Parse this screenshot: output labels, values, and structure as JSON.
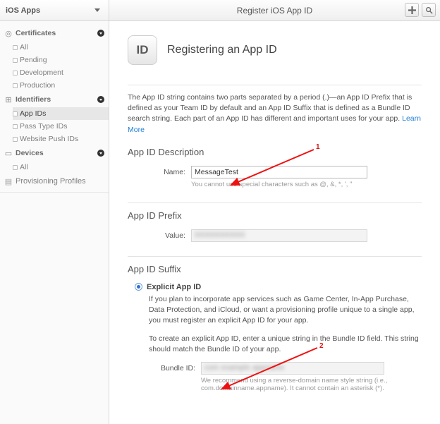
{
  "sidebar": {
    "header": "iOS Apps",
    "sections": [
      {
        "label": "Certificates",
        "items": [
          "All",
          "Pending",
          "Development",
          "Production"
        ]
      },
      {
        "label": "Identifiers",
        "items": [
          "App IDs",
          "Pass Type IDs",
          "Website Push IDs"
        ]
      },
      {
        "label": "Devices",
        "items": [
          "All"
        ]
      }
    ],
    "leaf": "Provisioning Profiles"
  },
  "header": {
    "title": "Register iOS App ID"
  },
  "page": {
    "badge": "ID",
    "title": "Registering an App ID",
    "intro": "The App ID string contains two parts separated by a period (.)—an App ID Prefix that is defined as your Team ID by default and an App ID Suffix that is defined as a Bundle ID search string. Each part of an App ID has different and important uses for your app.",
    "learnMore": "Learn More"
  },
  "desc": {
    "title": "App ID Description",
    "label": "Name:",
    "value": "MessageTest",
    "hint": "You cannot use special characters such as @, &, *, ', \""
  },
  "prefix": {
    "title": "App ID Prefix",
    "label": "Value:",
    "value": "XXXXXXXXXX"
  },
  "suffix": {
    "title": "App ID Suffix",
    "explicit": {
      "title": "Explicit App ID",
      "p1": "If you plan to incorporate app services such as Game Center, In-App Purchase, Data Protection, and iCloud, or want a provisioning profile unique to a single app, you must register an explicit App ID for your app.",
      "p2": "To create an explicit App ID, enter a unique string in the Bundle ID field. This string should match the Bundle ID of your app.",
      "bundleLabel": "Bundle ID:",
      "bundleValue": "com example appname",
      "bundleHint": "We recommend using a reverse-domain name style string (i.e., com.domainname.appname). It cannot contain an asterisk (*)."
    }
  },
  "annotations": {
    "one": "1",
    "two": "2"
  }
}
